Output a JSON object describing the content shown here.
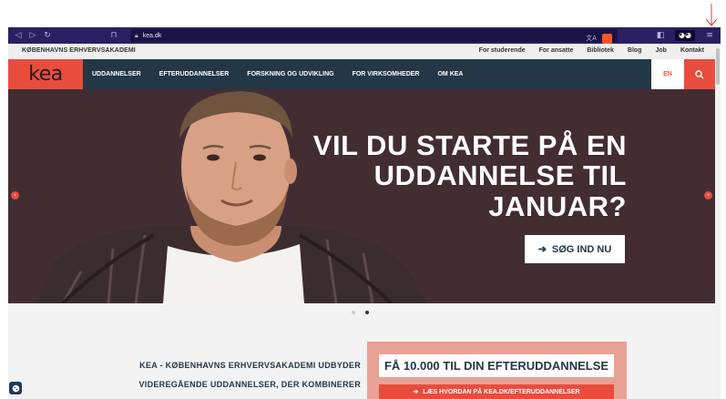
{
  "browser": {
    "url": "kea.dk",
    "icons": [
      "back-icon",
      "forward-icon",
      "reload-icon",
      "bookmark-icon",
      "lock-icon",
      "translate-icon",
      "brave-shield-icon",
      "sidebar-icon",
      "private-glasses-icon",
      "menu-icon"
    ]
  },
  "utility_bar": {
    "org_name": "KØBENHAVNS ERHVERVSAKADEMI",
    "links": [
      "For studerende",
      "For ansatte",
      "Bibliotek",
      "Blog",
      "Job",
      "Kontakt"
    ]
  },
  "main_nav": {
    "logo": "kea",
    "items": [
      "UDDANNELSER",
      "EFTERUDDANNELSER",
      "FORSKNING OG UDVIKLING",
      "FOR VIRKSOMHEDER",
      "OM KEA"
    ],
    "lang_label": "EN"
  },
  "hero": {
    "headline_lines": [
      "VIL DU STARTE PÅ EN",
      "UDDANNELSE TIL",
      "JANUAR?"
    ],
    "cta_arrow": "➔",
    "cta_label": "SØG IND NU"
  },
  "carousel": {
    "slide_count": 2,
    "active_index": 1
  },
  "intro": {
    "lines": [
      "KEA - KØBENHAVNS ERHVERVSAKADEMI UDBYDER",
      "VIDEREGÅENDE UDDANNELSER, DER KOMBINERER"
    ]
  },
  "promo": {
    "title": "FÅ 10.000 TIL DIN EFTERUDDANNELSE",
    "link_arrow": "➔",
    "link_label": "LÆS HVORDAN PÅ KEA.DK/EFTERUDDANNELSER"
  },
  "colors": {
    "accent": "#e94c3d",
    "navy": "#243746",
    "hero_bg": "#422d33",
    "browser_bar": "#2b1f63",
    "promo_bg": "#eaa196"
  }
}
